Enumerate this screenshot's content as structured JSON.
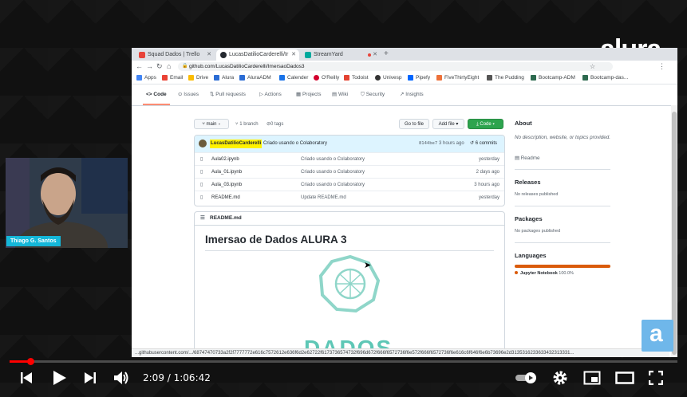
{
  "browser": {
    "tabs": [
      {
        "label": "Squad Dados | Trello",
        "active": false,
        "color": "#e8443a"
      },
      {
        "label": "LucasDatilioCarderelli/Ir",
        "active": true,
        "color": "#24292f"
      },
      {
        "label": "StreamYard",
        "active": false,
        "color": "#00a99d"
      }
    ],
    "url": "github.com/LucasDatilioCarderelli/ImersaoDados3",
    "bookmarks": [
      "Apps",
      "Email",
      "Drive",
      "Alura",
      "AluraADM",
      "Calender",
      "O'Reilly",
      "Todoist",
      "Univesp",
      "Pipefy",
      "FiveThirtyEight",
      "The Pudding",
      "Bootcamp-ADM",
      "Bootcamp-das..."
    ],
    "status_url": "...githubusercontent.com/.../68747470733a2f2f7777772e616c7572612e636f6d2e62722f6173736574732f696d672f666f6572736f6e572f666f6572736f6e616c6f646f6e6b73696e2d3135316233633432313331..."
  },
  "repo": {
    "nav": [
      "Code",
      "Issues",
      "Pull requests",
      "Actions",
      "Projects",
      "Wiki",
      "Security",
      "Insights"
    ],
    "branch": "main",
    "branches": "1 branch",
    "tags": "0 tags",
    "goto_file": "Go to file",
    "add_file": "Add file",
    "code_btn": "Code",
    "commit": {
      "author": "LucasDatilioCarderelli",
      "message": "Criado usando o Colaboratory",
      "hash": "8144be7",
      "time": "3 hours ago",
      "commits": "6 commits"
    },
    "files": [
      {
        "name": "Aula02.ipynb",
        "message": "Criado usando o Colaboratory",
        "time": "yesterday"
      },
      {
        "name": "Aula_01.ipynb",
        "message": "Criado usando o Colaboratory",
        "time": "2 days ago"
      },
      {
        "name": "Aula_03.ipynb",
        "message": "Criado usando o Colaboratory",
        "time": "3 hours ago"
      },
      {
        "name": "README.md",
        "message": "Update README.md",
        "time": "yesterday"
      }
    ],
    "readme_label": "README.md",
    "readme_title": "Imersao de Dados ALURA 3",
    "readme_logo_text": "DADOS"
  },
  "sidebar": {
    "about_h": "About",
    "about_text": "No description, website, or topics provided.",
    "readme_link": "Readme",
    "releases_h": "Releases",
    "releases_text": "No releases published",
    "packages_h": "Packages",
    "packages_text": "No packages published",
    "languages_h": "Languages",
    "language": "Jupyter Notebook",
    "language_pct": "100.0%",
    "language_color": "#DA5B0B"
  },
  "overlay": {
    "brand": "alura",
    "presenter": "Thiago G. Santos",
    "corner_logo": "a"
  },
  "player": {
    "time": "2:09 / 1:06:42",
    "progress": 0.032,
    "accent": "#ff0000"
  }
}
